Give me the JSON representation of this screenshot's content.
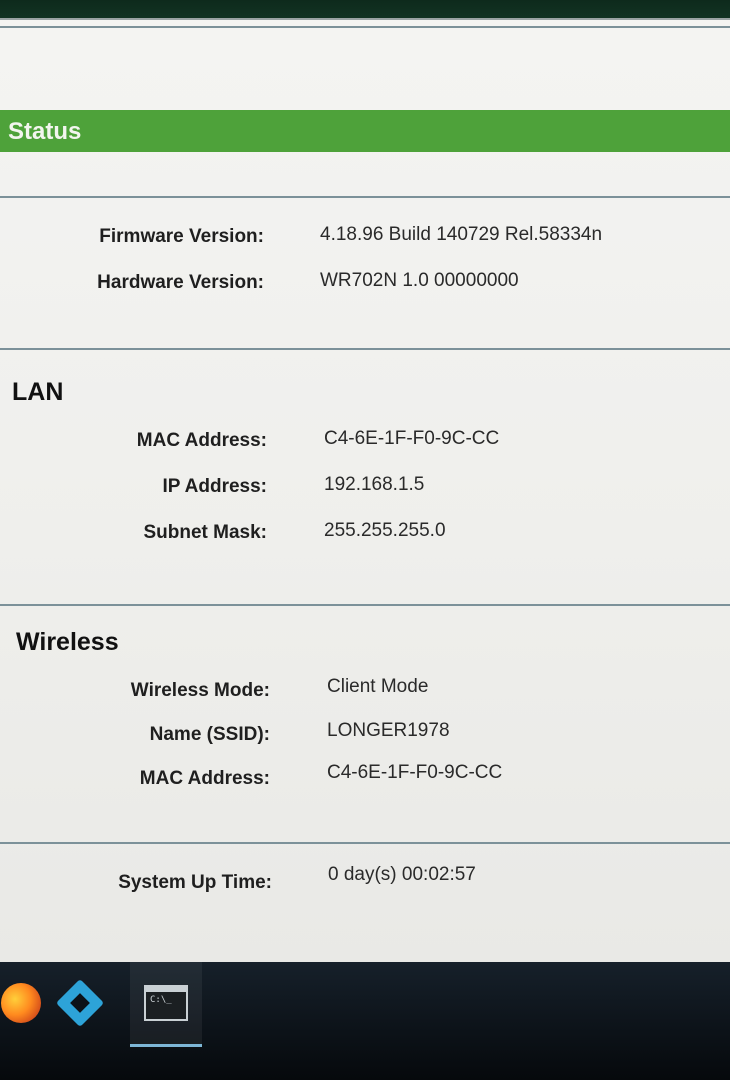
{
  "header": {
    "title": "Status"
  },
  "firmware": [
    {
      "label": "Firmware Version:",
      "value": "4.18.96 Build 140729 Rel.58334n"
    },
    {
      "label": "Hardware Version:",
      "value": "WR702N 1.0 00000000"
    }
  ],
  "lan": {
    "title": "LAN",
    "rows": [
      {
        "label": "MAC Address:",
        "value": "C4-6E-1F-F0-9C-CC"
      },
      {
        "label": "IP Address:",
        "value": "192.168.1.5"
      },
      {
        "label": "Subnet Mask:",
        "value": "255.255.255.0"
      }
    ]
  },
  "wireless": {
    "title": "Wireless",
    "rows": [
      {
        "label": "Wireless Mode:",
        "value": "Client Mode"
      },
      {
        "label": "Name (SSID):",
        "value": "LONGER1978"
      },
      {
        "label": "MAC Address:",
        "value": "C4-6E-1F-F0-9C-CC"
      }
    ]
  },
  "system": {
    "label": "System Up Time:",
    "value": "0  day(s) 00:02:57"
  },
  "taskbar": {
    "items": [
      {
        "icon": "firefox-icon"
      },
      {
        "icon": "kodi-icon"
      },
      {
        "icon": "terminal-icon",
        "active": true
      }
    ]
  }
}
